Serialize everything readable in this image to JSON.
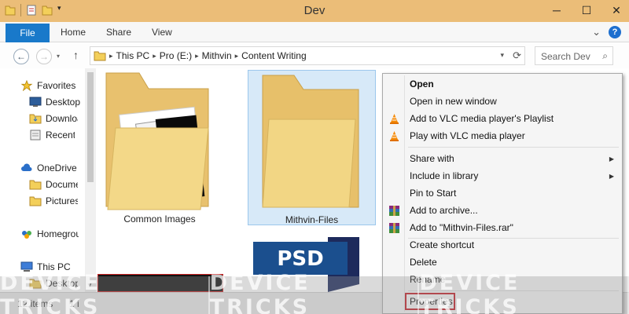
{
  "window": {
    "title": "Dev",
    "minimize": "─",
    "maximize": "☐",
    "close": "✕"
  },
  "ribbon": {
    "tabs": [
      "File",
      "Home",
      "Share",
      "View"
    ],
    "expand": "⌄",
    "help": "?"
  },
  "address": {
    "back": "←",
    "forward": "→",
    "up": "↑",
    "crumbs": [
      "This PC",
      "Pro (E:)",
      "Mithvin",
      "Content Writing"
    ],
    "dropdown": "▾",
    "refresh": "⟳",
    "search_placeholder": "Search Dev",
    "search_icon": "⌕"
  },
  "nav": {
    "items": [
      {
        "label": "Favorites",
        "icon": "star-icon"
      },
      {
        "label": "Desktop",
        "icon": "desktop-icon"
      },
      {
        "label": "Downloads",
        "icon": "downloads-icon"
      },
      {
        "label": "Recent places",
        "icon": "recent-icon"
      },
      {
        "label": "OneDrive",
        "icon": "cloud-icon"
      },
      {
        "label": "Documents",
        "icon": "folder-icon"
      },
      {
        "label": "Pictures",
        "icon": "folder-icon"
      },
      {
        "label": "Homegroup",
        "icon": "homegroup-icon"
      },
      {
        "label": "This PC",
        "icon": "computer-icon"
      },
      {
        "label": "Desktop",
        "icon": "folder-icon"
      }
    ]
  },
  "content": {
    "items": [
      {
        "label": "Common Images"
      },
      {
        "label": "Mithvin-Files",
        "selected": true
      },
      {
        "label": "PSD"
      }
    ]
  },
  "context_menu": {
    "items": [
      {
        "label": "Open",
        "bold": true
      },
      {
        "label": "Open in new window"
      },
      {
        "label": "Add to VLC media player's Playlist",
        "icon": "vlc-icon"
      },
      {
        "label": "Play with VLC media player",
        "icon": "vlc-icon"
      },
      {
        "label": "Share with",
        "submenu": true
      },
      {
        "label": "Include in library",
        "submenu": true
      },
      {
        "label": "Pin to Start"
      },
      {
        "label": "Add to archive...",
        "icon": "winrar-icon"
      },
      {
        "label": "Add to \"Mithvin-Files.rar\"",
        "icon": "winrar-icon"
      },
      {
        "label": "Create shortcut"
      },
      {
        "label": "Delete"
      },
      {
        "label": "Rename"
      },
      {
        "label": "Properties",
        "highlighted": true
      }
    ],
    "submenu_arrow": "▶"
  },
  "status": {
    "count": "12 items",
    "selection": "1 i"
  },
  "watermark": {
    "text": "DEVICE TRICKS"
  },
  "colors": {
    "titlebar": "#ebbd78",
    "file_tab": "#1979ca",
    "selection": "#d7e9f8",
    "highlight_border": "#c21f28"
  }
}
